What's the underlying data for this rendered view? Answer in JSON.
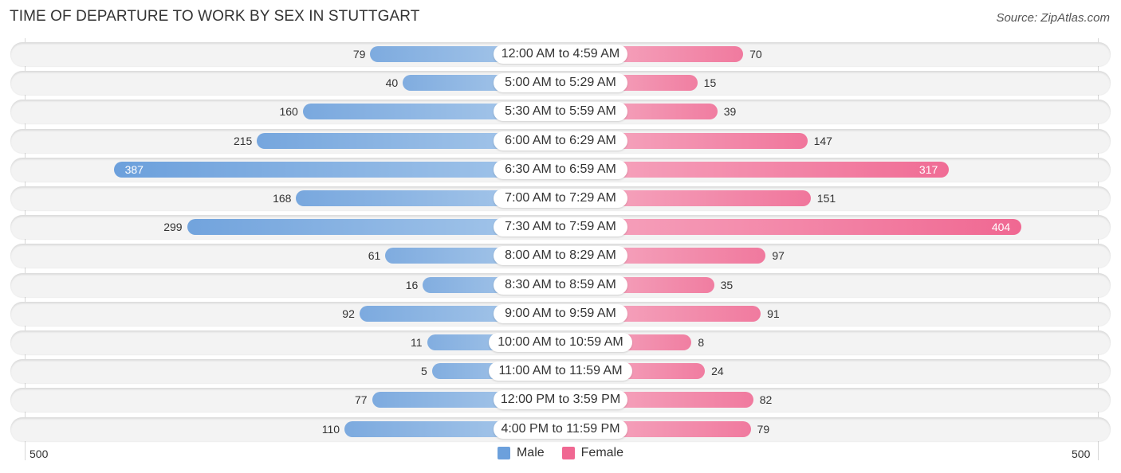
{
  "title": "TIME OF DEPARTURE TO WORK BY SEX IN STUTTGART",
  "source": "Source: ZipAtlas.com",
  "colors": {
    "male": "#6ca0dc",
    "male_light": "#a4c6ea",
    "female": "#f06892",
    "female_light": "#f6a6bf"
  },
  "chart_data": {
    "type": "bar",
    "orientation": "horizontal-diverging",
    "title": "TIME OF DEPARTURE TO WORK BY SEX IN STUTTGART",
    "categories": [
      "12:00 AM to 4:59 AM",
      "5:00 AM to 5:29 AM",
      "5:30 AM to 5:59 AM",
      "6:00 AM to 6:29 AM",
      "6:30 AM to 6:59 AM",
      "7:00 AM to 7:29 AM",
      "7:30 AM to 7:59 AM",
      "8:00 AM to 8:29 AM",
      "8:30 AM to 8:59 AM",
      "9:00 AM to 9:59 AM",
      "10:00 AM to 10:59 AM",
      "11:00 AM to 11:59 AM",
      "12:00 PM to 3:59 PM",
      "4:00 PM to 11:59 PM"
    ],
    "series": [
      {
        "name": "Male",
        "values": [
          79,
          40,
          160,
          215,
          387,
          168,
          299,
          61,
          16,
          92,
          11,
          5,
          77,
          110
        ]
      },
      {
        "name": "Female",
        "values": [
          70,
          15,
          39,
          147,
          317,
          151,
          404,
          97,
          35,
          91,
          8,
          24,
          82,
          79
        ]
      }
    ],
    "axis": {
      "left_label": "500",
      "right_label": "500",
      "range": [
        0,
        500
      ]
    },
    "legend": {
      "position": "bottom-center",
      "entries": [
        "Male",
        "Female"
      ]
    },
    "grid": false
  }
}
